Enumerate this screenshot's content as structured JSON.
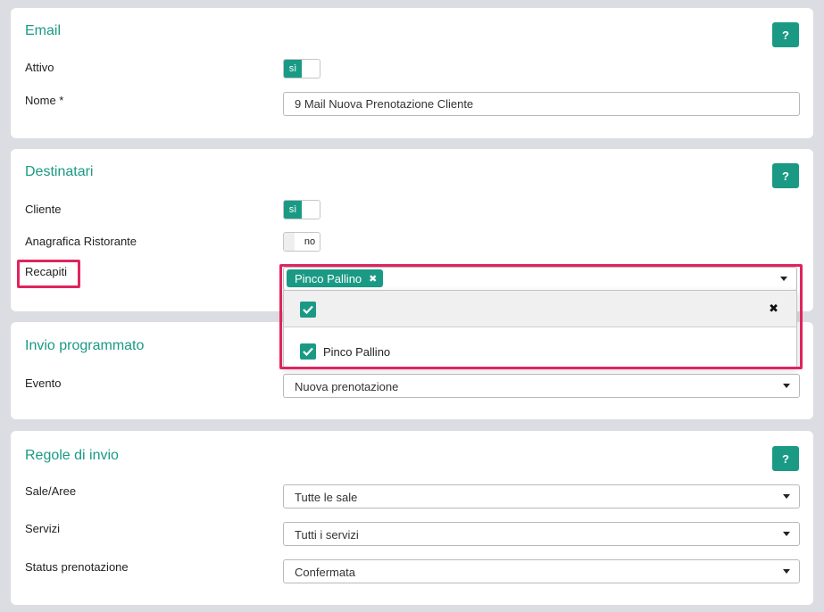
{
  "email": {
    "title": "Email",
    "help": "?",
    "attivo_label": "Attivo",
    "attivo_value": "sì",
    "nome_label": "Nome *",
    "nome_value": "9 Mail Nuova Prenotazione Cliente"
  },
  "destinatari": {
    "title": "Destinatari",
    "help": "?",
    "cliente_label": "Cliente",
    "cliente_value": "sì",
    "anagrafica_label": "Anagrafica Ristorante",
    "anagrafica_value": "no",
    "recapiti_label": "Recapiti",
    "recapiti_tags": [
      "Pinco Pallino"
    ],
    "dropdown_options": [
      {
        "label": "Pinco Pallino",
        "checked": true
      }
    ]
  },
  "invio": {
    "title": "Invio programmato",
    "evento_label": "Evento",
    "evento_value": "Nuova prenotazione"
  },
  "regole": {
    "title": "Regole di invio",
    "help": "?",
    "sale_label": "Sale/Aree",
    "sale_value": "Tutte le sale",
    "servizi_label": "Servizi",
    "servizi_value": "Tutti i servizi",
    "status_label": "Status prenotazione",
    "status_value": "Confermata"
  },
  "colors": {
    "accent": "#1a9a84",
    "highlight": "#e0245e"
  }
}
